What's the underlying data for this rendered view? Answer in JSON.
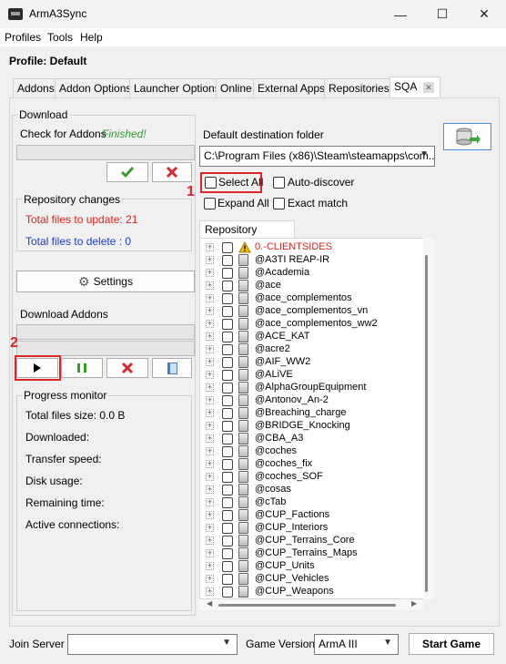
{
  "window": {
    "title": "ArmA3Sync",
    "controls": [
      "—",
      "☐",
      "✕"
    ]
  },
  "menu": [
    "Profiles",
    "Tools",
    "Help"
  ],
  "profile": "Profile: Default",
  "tabs": [
    "Addons",
    "Addon Options",
    "Launcher Options",
    "Online",
    "External Apps",
    "Repositories",
    "SQA"
  ],
  "download": {
    "group_label": "Download",
    "check_label": "Check for Addons",
    "check_status": "Finished!",
    "changes_label": "Repository changes",
    "files_update": "Total files to update: 21",
    "files_delete": "Total files to delete : 0",
    "settings_label": "Settings",
    "download_addons_label": "Download Addons"
  },
  "progress": {
    "label": "Progress monitor",
    "total_size": "Total files size: 0.0 B",
    "downloaded": "Downloaded:",
    "transfer": "Transfer speed:",
    "disk": "Disk usage:",
    "remaining": "Remaining time:",
    "connections": "Active connections:"
  },
  "destination": {
    "label": "Default destination folder",
    "value": "C:\\Program Files (x86)\\Steam\\steamapps\\com..."
  },
  "options": {
    "select_all": "Select All",
    "auto_discover": "Auto-discover",
    "expand_all": "Expand All",
    "exact_match": "Exact match"
  },
  "repo_content_label": "Repository content",
  "tree_items": [
    "0.-CLIENTSIDES",
    "@A3TI REAP-IR",
    "@Academia",
    "@ace",
    "@ace_complementos",
    "@ace_complementos_vn",
    "@ace_complementos_ww2",
    "@ACE_KAT",
    "@acre2",
    "@AIF_WW2",
    "@ALiVE",
    "@AlphaGroupEquipment",
    "@Antonov_An-2",
    "@Breaching_charge",
    "@BRIDGE_Knocking",
    "@CBA_A3",
    "@coches",
    "@coches_fix",
    "@coches_SOF",
    "@cosas",
    "@cTab",
    "@CUP_Factions",
    "@CUP_Interiors",
    "@CUP_Terrains_Core",
    "@CUP_Terrains_Maps",
    "@CUP_Units",
    "@CUP_Vehicles",
    "@CUP_Weapons"
  ],
  "annotations": {
    "one": "1",
    "two": "2"
  },
  "bottom": {
    "join_server": "Join Server",
    "game_version_label": "Game Version",
    "game_version": "ArmA III",
    "start": "Start Game"
  },
  "colors": {
    "finished": "#2e9e2e",
    "update": "#e0201a",
    "delete": "#1a3ed0",
    "highlight": "#d9262d",
    "warning_item": "#e0201a"
  }
}
